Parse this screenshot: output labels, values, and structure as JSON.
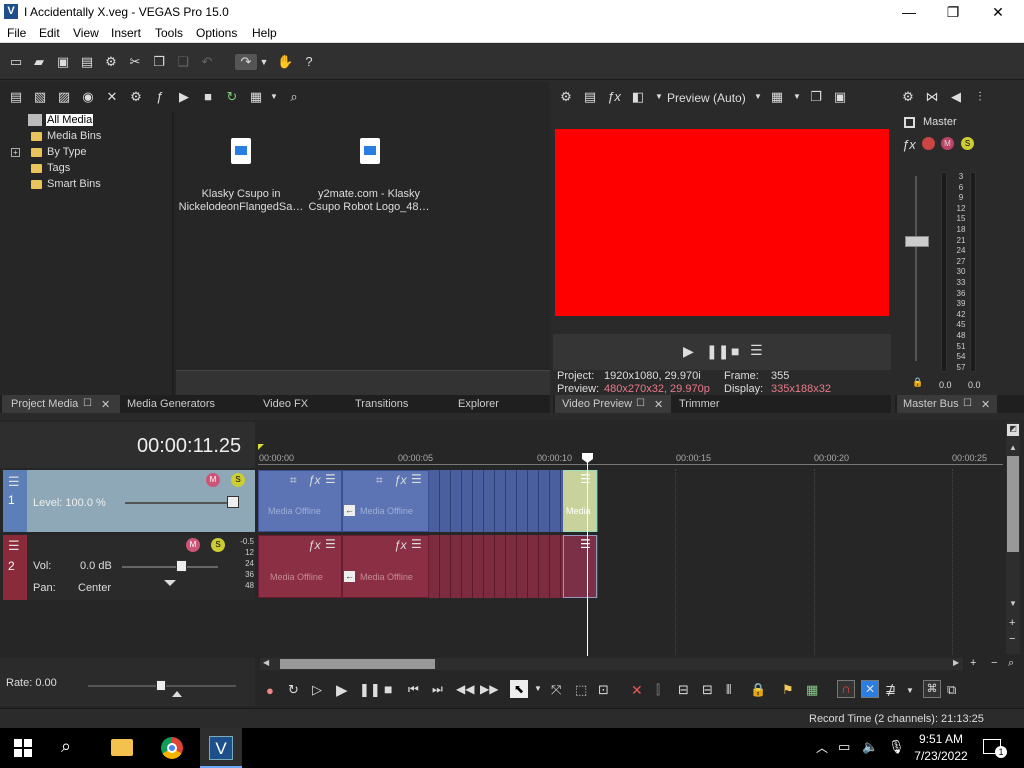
{
  "window": {
    "title": "I Accidentally X.veg - VEGAS Pro 15.0",
    "logo_letter": "V"
  },
  "menu": [
    "File",
    "Edit",
    "View",
    "Insert",
    "Tools",
    "Options",
    "Help"
  ],
  "project_media": {
    "tree": [
      "All Media",
      "Media Bins",
      "By Type",
      "Tags",
      "Smart Bins"
    ],
    "files": [
      {
        "line1": "Klasky Csupo in",
        "line2": "NickelodeonFlangedSa…"
      },
      {
        "line1": "y2mate.com - Klasky",
        "line2": "Csupo Robot Logo_48…"
      }
    ],
    "tabs": [
      "Project Media",
      "Media Generators",
      "Video FX",
      "Transitions",
      "Explorer"
    ]
  },
  "preview": {
    "mode": "Preview (Auto)",
    "project_label": "Project:",
    "project_value": "1920x1080, 29.970i",
    "preview_label": "Preview:",
    "preview_value": "480x270x32, 29.970p",
    "frame_label": "Frame:",
    "frame_value": "355",
    "display_label": "Display:",
    "display_value": "335x188x32",
    "tabs": [
      "Video Preview",
      "Trimmer"
    ],
    "preview_color": "#ff0000"
  },
  "master": {
    "label": "Master",
    "scale": [
      "3",
      "6",
      "9",
      "12",
      "15",
      "18",
      "21",
      "24",
      "27",
      "30",
      "33",
      "36",
      "39",
      "42",
      "45",
      "48",
      "51",
      "54",
      "57"
    ],
    "left_value": "0.0",
    "right_value": "0.0",
    "tab": "Master Bus"
  },
  "timeline": {
    "time": "00:00:11.25",
    "ruler": [
      "00:00:00",
      "00:00:05",
      "00:00:10",
      "00:00:15",
      "00:00:20",
      "00:00:25"
    ],
    "track1": {
      "number": "1",
      "level": "Level: 100.0 %"
    },
    "track2": {
      "number": "2",
      "vol_label": "Vol:",
      "vol_value": "0.0 dB",
      "pan_label": "Pan:",
      "pan_value": "Center",
      "db_marks": [
        "-0.5",
        "12",
        "24",
        "36",
        "48"
      ]
    },
    "clip_label": "Media Offline",
    "clip_label_short": "Media",
    "rate": "Rate: 0.00"
  },
  "status": {
    "record_time": "Record Time (2 channels): 21:13:25"
  },
  "taskbar": {
    "time": "9:51 AM",
    "date": "7/23/2022",
    "notif_count": "1"
  }
}
